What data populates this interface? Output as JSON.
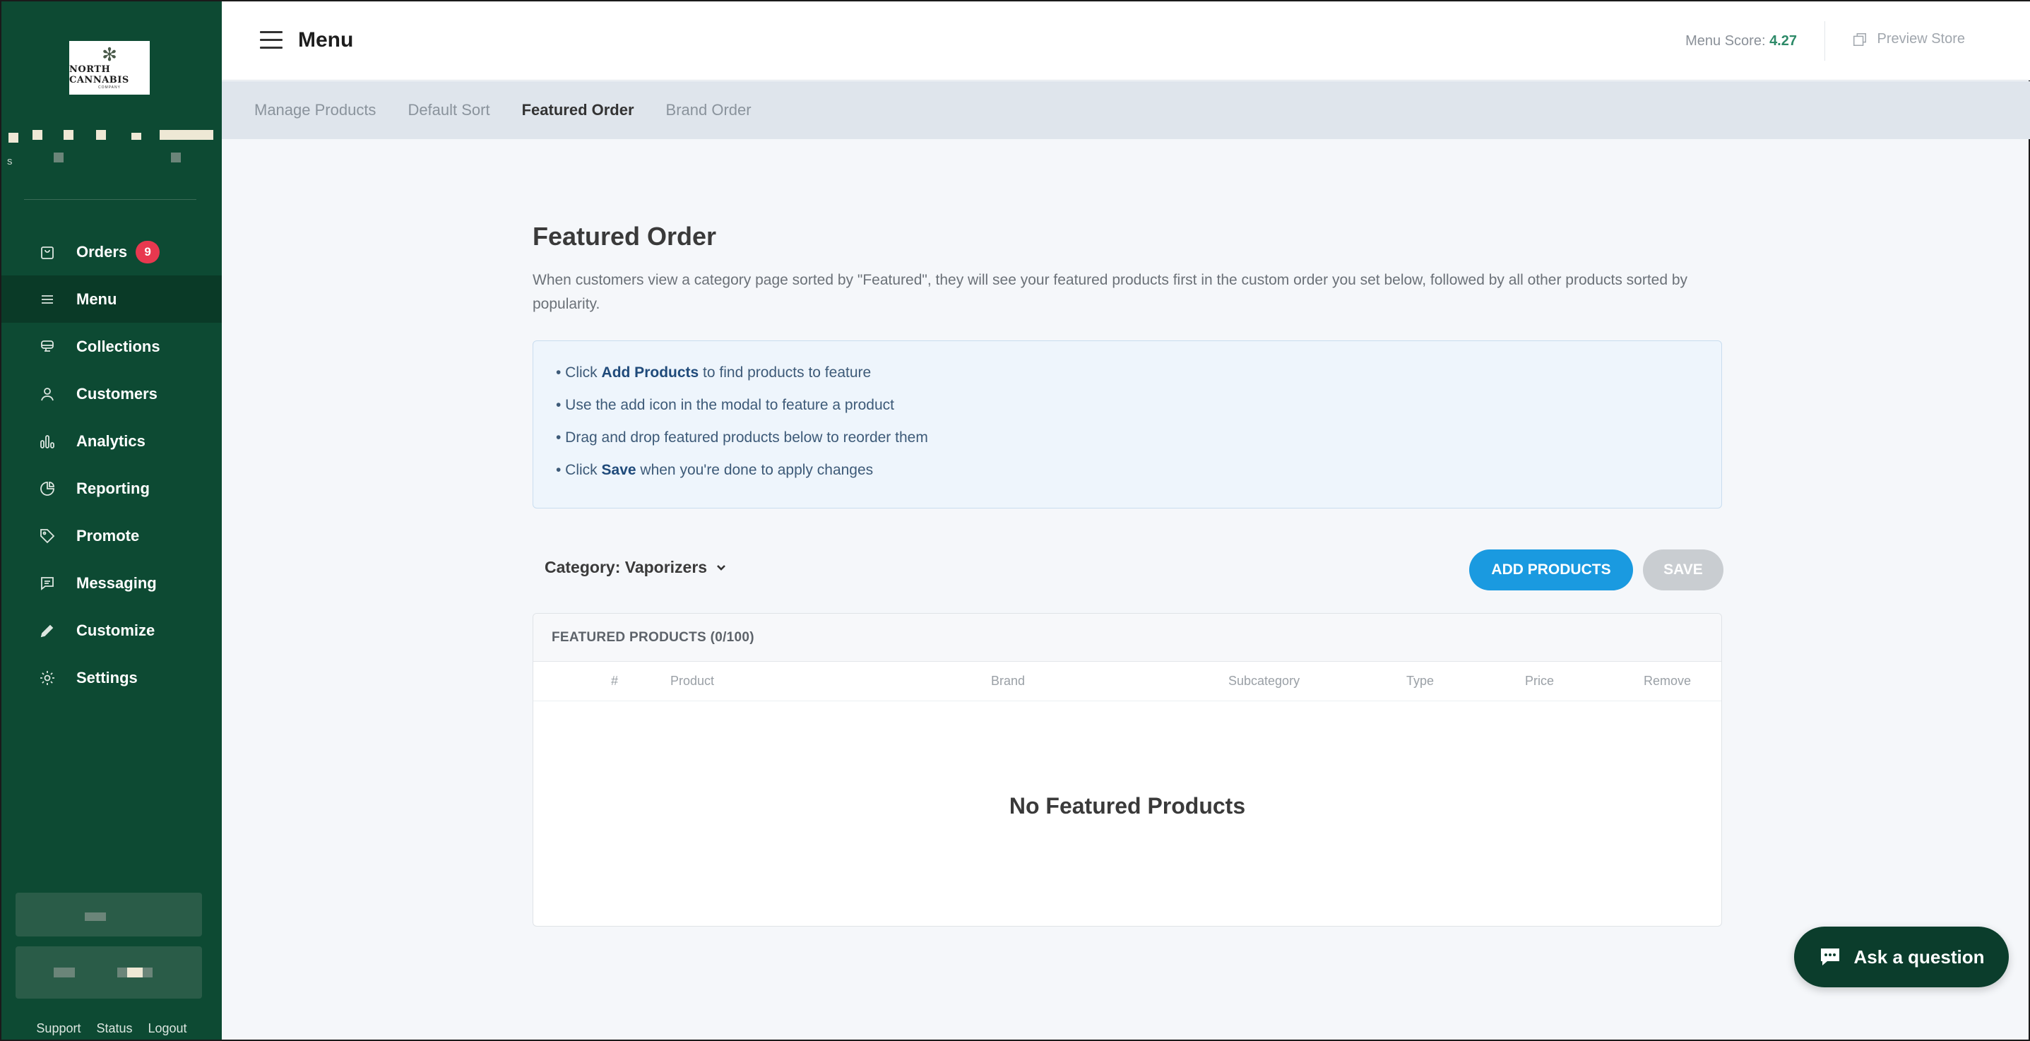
{
  "sidebar": {
    "logo": {
      "text": "NORTH CANNABIS",
      "sub": "COMPANY"
    },
    "pix_s": "s",
    "nav": [
      {
        "id": "orders",
        "label": "Orders",
        "badge": "9",
        "icon": "shopping-bag-icon"
      },
      {
        "id": "menu",
        "label": "Menu",
        "icon": "list-icon",
        "active": true
      },
      {
        "id": "collections",
        "label": "Collections",
        "icon": "tray-icon"
      },
      {
        "id": "customers",
        "label": "Customers",
        "icon": "person-icon"
      },
      {
        "id": "analytics",
        "label": "Analytics",
        "icon": "bar-chart-icon"
      },
      {
        "id": "reporting",
        "label": "Reporting",
        "icon": "pie-chart-icon"
      },
      {
        "id": "promote",
        "label": "Promote",
        "icon": "tag-icon"
      },
      {
        "id": "messaging",
        "label": "Messaging",
        "icon": "chat-bubble-icon"
      },
      {
        "id": "customize",
        "label": "Customize",
        "icon": "pencil-icon"
      },
      {
        "id": "settings",
        "label": "Settings",
        "icon": "gear-icon"
      }
    ],
    "footer": {
      "support": "Support",
      "status": "Status",
      "logout": "Logout"
    }
  },
  "topbar": {
    "title": "Menu",
    "menu_score_label": "Menu Score:",
    "menu_score_value": "4.27",
    "preview_store": "Preview Store"
  },
  "subtabs": [
    {
      "label": "Manage Products"
    },
    {
      "label": "Default Sort"
    },
    {
      "label": "Featured Order",
      "active": true
    },
    {
      "label": "Brand Order"
    }
  ],
  "main": {
    "title": "Featured Order",
    "description": "When customers view a category page sorted by \"Featured\", they will see your featured products first in the custom order you set below, followed by all other products sorted by popularity.",
    "instructions": {
      "l1_pre": "• Click ",
      "l1_bold": "Add Products",
      "l1_post": " to find products to feature",
      "l2": "• Use the add icon in the modal to feature a product",
      "l3": "• Drag and drop featured products below to reorder them",
      "l4_pre": "• Click ",
      "l4_bold": "Save",
      "l4_post": " when you're done to apply changes"
    },
    "category_label": "Category: Vaporizers",
    "add_products_button": "ADD PRODUCTS",
    "save_button": "SAVE",
    "table": {
      "heading": "FEATURED PRODUCTS (0/100)",
      "columns": {
        "num": "#",
        "product": "Product",
        "brand": "Brand",
        "subcategory": "Subcategory",
        "type": "Type",
        "price": "Price",
        "remove": "Remove"
      },
      "empty_text": "No Featured Products"
    }
  },
  "chat": {
    "label": "Ask a question"
  },
  "colors": {
    "sidebar_bg": "#0d4a33",
    "accent_blue": "#1a9ae0",
    "badge_red": "#e8384f",
    "score_green": "#2d8a68"
  }
}
